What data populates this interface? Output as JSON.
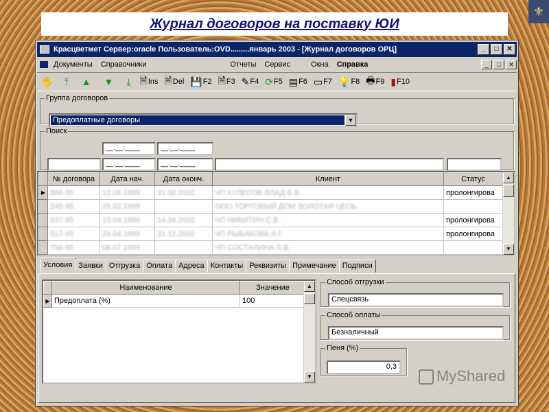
{
  "banner": {
    "title": "Журнал договоров на поставку ЮИ"
  },
  "window": {
    "title": "Красцветмет  Сервер:oracle Пользователь:OVD.........январь 2003 - [Журнал договоров ОРЦ]",
    "buttons": {
      "minimize": "_",
      "maximize": "□",
      "close": "✕"
    }
  },
  "menu": {
    "left": [
      "Документы",
      "Справочники"
    ],
    "right": [
      "Отчеты",
      "Сервис",
      "Окна",
      "Справка"
    ]
  },
  "toolbar": {
    "buttons": [
      {
        "glyph": "🖐",
        "label": ""
      },
      {
        "glyph": "⤒",
        "label": ""
      },
      {
        "glyph": "▲",
        "label": ""
      },
      {
        "glyph": "▼",
        "label": ""
      },
      {
        "glyph": "⤓",
        "label": ""
      },
      {
        "glyph": "🗎",
        "label": "Ins"
      },
      {
        "glyph": "🗎",
        "label": "Del"
      },
      {
        "glyph": "💾",
        "label": "F2"
      },
      {
        "glyph": "🗎",
        "label": "F3"
      },
      {
        "glyph": "✎",
        "label": "F4"
      },
      {
        "glyph": "⟳",
        "label": "F5"
      },
      {
        "glyph": "▤",
        "label": "F6"
      },
      {
        "glyph": "▭",
        "label": "F7"
      },
      {
        "glyph": "💡",
        "label": "F8"
      },
      {
        "glyph": "🖶",
        "label": "F9"
      },
      {
        "glyph": "▮",
        "label": "F10"
      }
    ]
  },
  "group": {
    "legend": "Группа договоров",
    "selected": "Предоплатные договоры"
  },
  "search": {
    "legend": "Поиск",
    "date_placeholder": "__.__.____"
  },
  "grid": {
    "columns": [
      "№ договора",
      "Дата нач.",
      "Дата оконч.",
      "Клиент",
      "Статус"
    ],
    "rows": [
      [
        "866-95",
        "12.08.1999",
        "31.08.2002",
        "ЧП КУЛЕСОВ ВЛАД Б.В.",
        "пролонгирова"
      ],
      [
        "248-95",
        "25.02.1999",
        "",
        "ООО ТОРГОВЫЙ ДОМ ЗОЛОТАЯ ЦЕПЬ",
        ""
      ],
      [
        "837-95",
        "15.04.1999",
        "14.04.2002",
        "ЧП НИКИТИН С.В.",
        "пролонгирова"
      ],
      [
        "517-95",
        "29.04.1999",
        "31.12.2002",
        "ЧП РЫБАКОВА Л.Г.",
        "пролонгирова"
      ],
      [
        "756-95",
        "06.07.1999",
        "",
        "ЧП СОСТАЛИНА Л.В.",
        ""
      ]
    ]
  },
  "tabs": [
    "Условия",
    "Заявки",
    "Отгрузка",
    "Оплата",
    "Адреса",
    "Контакты",
    "Реквизиты",
    "Примечание",
    "Подписи"
  ],
  "conditions": {
    "columns": [
      "Наименование",
      "Значение"
    ],
    "rows": [
      [
        "Предоплата (%)",
        "100"
      ]
    ]
  },
  "shipping": {
    "legend": "Способ отгрузки",
    "value": "Спецсвязь"
  },
  "payment": {
    "legend": "Способ оплаты",
    "value": "Безналичный"
  },
  "penalty": {
    "legend": "Пеня (%)",
    "value": "0,3"
  },
  "watermark": {
    "text": "MyShared"
  }
}
